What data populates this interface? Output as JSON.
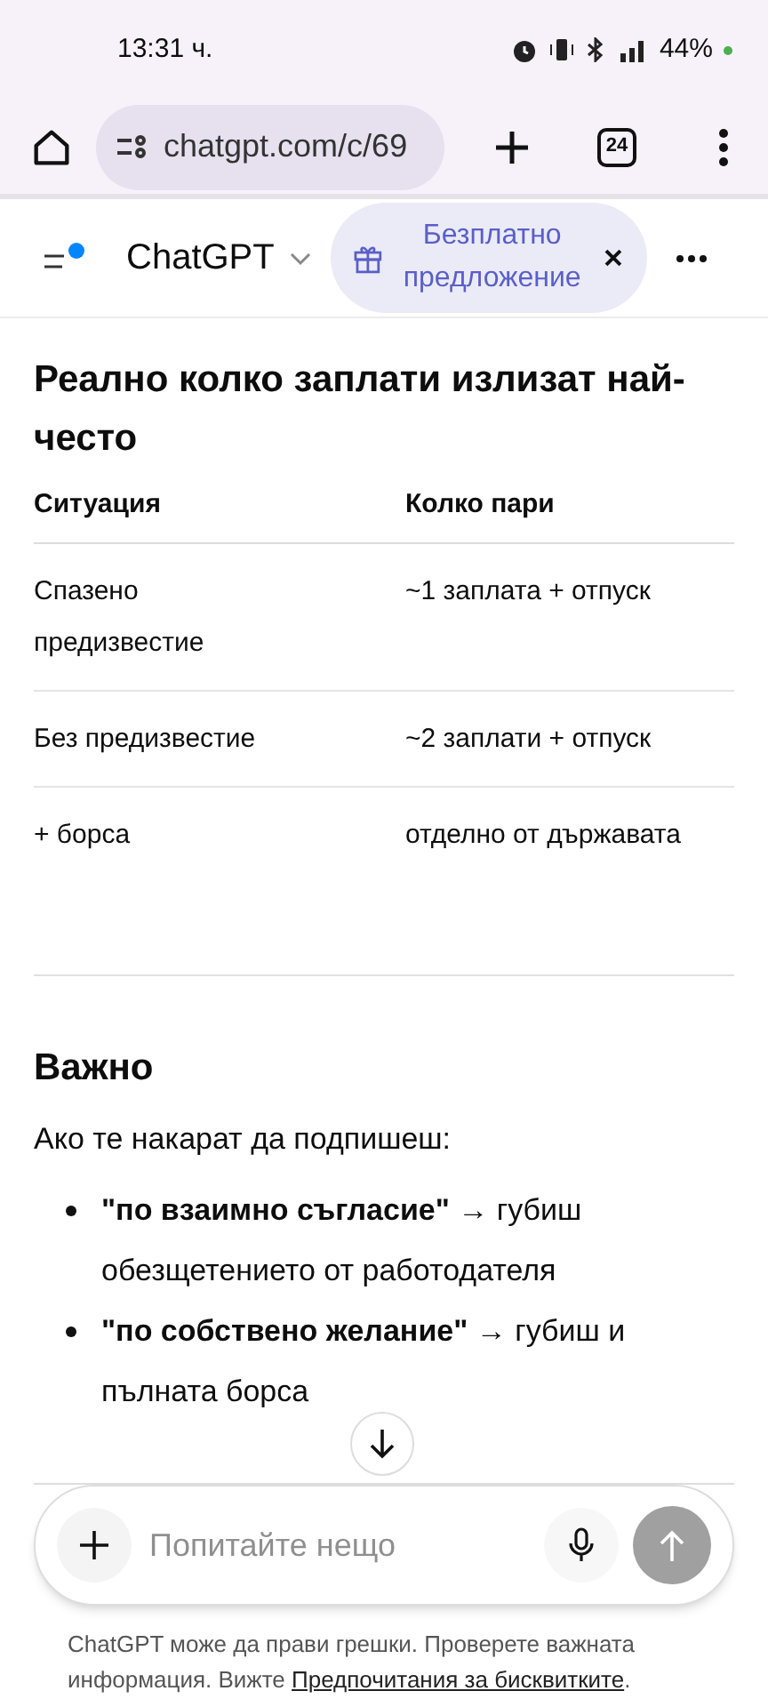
{
  "status_bar": {
    "time": "13:31 ч.",
    "battery": "44%"
  },
  "browser": {
    "url": "chatgpt.com/c/69",
    "tab_count": "24"
  },
  "app_header": {
    "title": "ChatGPT",
    "promo": "Безплатно предложение"
  },
  "content": {
    "heading": "Реално колко заплати излизат най-често",
    "table": {
      "columns": [
        "Ситуация",
        "Колко пари"
      ],
      "rows": [
        [
          "Спазено предизвестие",
          "~1 заплата + отпуск"
        ],
        [
          "Без предизвестие",
          "~2 заплати + отпуск"
        ],
        [
          "+ борса",
          "отделно от държавата"
        ]
      ]
    },
    "section_title": "Важно",
    "intro": "Ако те накарат да подпишеш:",
    "bullets": [
      "**\"по взаимно съгласие\"** → губиш обезщетението от работодателя",
      "**\"по собствено желание\"** → губиш и пълната борса"
    ]
  },
  "composer": {
    "placeholder": "Попитайте нещо"
  },
  "disclaimer": {
    "text": "ChatGPT може да прави грешки. Проверете важната информация. Вижте",
    "link": "Предпочитания за бисквитките",
    "end": "."
  }
}
